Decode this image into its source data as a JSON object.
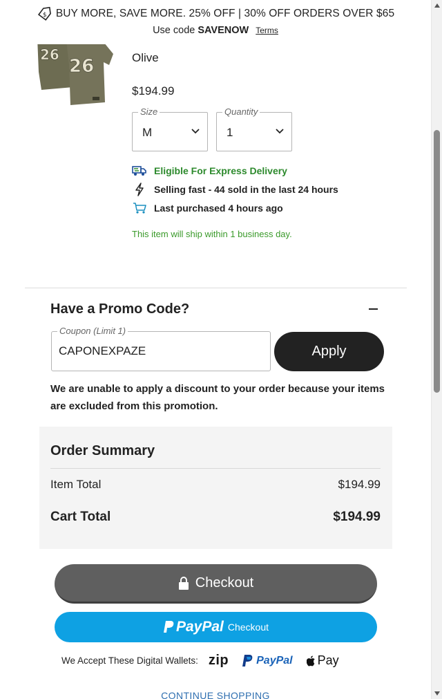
{
  "banner": {
    "promo_text": "BUY MORE, SAVE MORE. 25% OFF | 30% OFF ORDERS OVER $65",
    "code_prefix": "Use code",
    "code": "SAVENOW",
    "terms_label": "Terms"
  },
  "product": {
    "color": "Olive",
    "price": "$194.99",
    "image_icon": "jersey-image"
  },
  "size_select": {
    "legend": "Size",
    "value": "M"
  },
  "quantity_select": {
    "legend": "Quantity",
    "value": "1"
  },
  "info": {
    "express": "Eligible For Express Delivery",
    "selling": "Selling fast - 44 sold in the last 24 hours",
    "last_purchased": "Last purchased 4 hours ago",
    "ship_note": "This item will ship within 1 business day."
  },
  "promo": {
    "title": "Have a Promo Code?",
    "coupon_legend": "Coupon (Limit 1)",
    "coupon_value": "CAPONEXPAZE",
    "apply_label": "Apply",
    "message": "We are unable to apply a discount to your order because your items are excluded from this promotion."
  },
  "summary": {
    "title": "Order Summary",
    "item_total_label": "Item Total",
    "item_total_value": "$194.99",
    "cart_total_label": "Cart Total",
    "cart_total_value": "$194.99"
  },
  "checkout": {
    "label": "Checkout",
    "paypal_word": "PayPal",
    "paypal_checkout": "Checkout"
  },
  "wallets": {
    "label": "We Accept These Digital Wallets:",
    "zip": "zip",
    "paypal": "PayPal",
    "apple_pay": "Pay"
  },
  "continue_label": "CONTINUE SHOPPING",
  "colors": {
    "express_green": "#2d8a2d",
    "paypal_blue": "#0ea1e3",
    "checkout_gray": "#5f5f5f",
    "apply_black": "#222222"
  }
}
